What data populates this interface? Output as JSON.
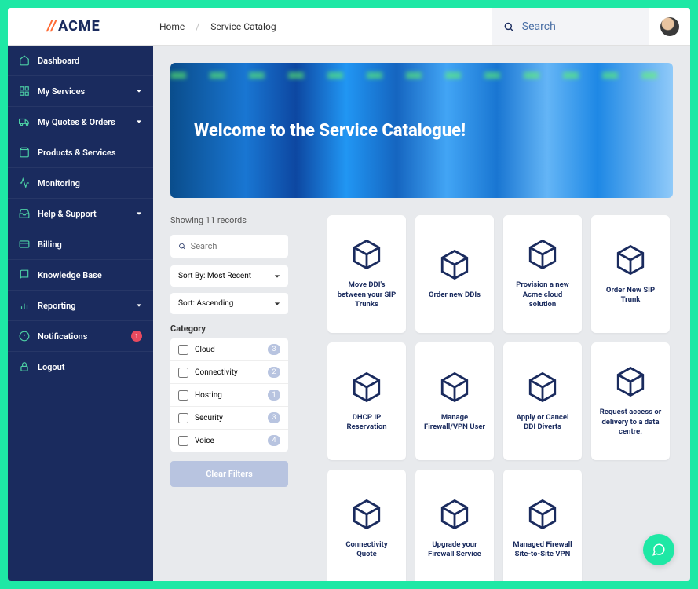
{
  "brand": "ACME",
  "breadcrumb": {
    "home": "Home",
    "page": "Service Catalog"
  },
  "search": {
    "placeholder": "Search"
  },
  "sidebar": {
    "items": [
      {
        "label": "Dashboard",
        "icon": "home",
        "expandable": false
      },
      {
        "label": "My Services",
        "icon": "services",
        "expandable": true
      },
      {
        "label": "My Quotes & Orders",
        "icon": "truck",
        "expandable": true
      },
      {
        "label": "Products & Services",
        "icon": "bag",
        "expandable": false
      },
      {
        "label": "Monitoring",
        "icon": "activity",
        "expandable": false
      },
      {
        "label": "Help & Support",
        "icon": "inbox",
        "expandable": true
      },
      {
        "label": "Billing",
        "icon": "card",
        "expandable": false
      },
      {
        "label": "Knowledge Base",
        "icon": "book",
        "expandable": false
      },
      {
        "label": "Reporting",
        "icon": "chart",
        "expandable": true
      },
      {
        "label": "Notifications",
        "icon": "alert",
        "expandable": false,
        "badge": "1"
      },
      {
        "label": "Logout",
        "icon": "lock",
        "expandable": false
      }
    ]
  },
  "hero": {
    "title": "Welcome to the Service Catalogue!"
  },
  "filters": {
    "records_text": "Showing 11 records",
    "search_placeholder": "Search",
    "sort_by": "Sort By: Most Recent",
    "sort_dir": "Sort: Ascending",
    "category_label": "Category",
    "categories": [
      {
        "label": "Cloud",
        "count": "3"
      },
      {
        "label": "Connectivity",
        "count": "2"
      },
      {
        "label": "Hosting",
        "count": "1"
      },
      {
        "label": "Security",
        "count": "3"
      },
      {
        "label": "Voice",
        "count": "4"
      }
    ],
    "clear_label": "Clear Filters"
  },
  "cards": [
    {
      "title": "Move DDI's between your SIP Trunks"
    },
    {
      "title": "Order new DDIs"
    },
    {
      "title": "Provision a new Acme cloud solution"
    },
    {
      "title": "Order New SIP Trunk"
    },
    {
      "title": "DHCP IP Reservation"
    },
    {
      "title": "Manage Firewall/VPN User"
    },
    {
      "title": "Apply or Cancel DDI Diverts"
    },
    {
      "title": "Request access or delivery to a data centre."
    },
    {
      "title": "Connectivity Quote"
    },
    {
      "title": "Upgrade your Firewall Service"
    },
    {
      "title": "Managed Firewall Site-to-Site VPN"
    }
  ]
}
